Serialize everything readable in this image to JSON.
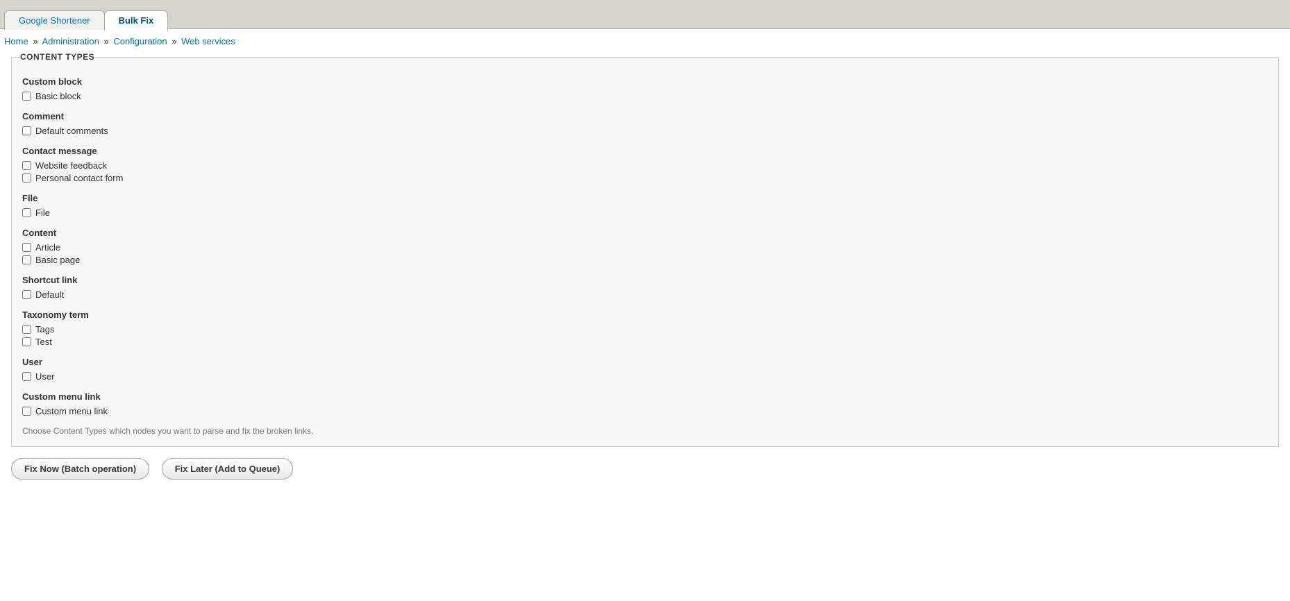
{
  "tabs": [
    {
      "label": "Google Shortener",
      "active": false
    },
    {
      "label": "Bulk Fix",
      "active": true
    }
  ],
  "breadcrumb": {
    "items": [
      {
        "label": "Home"
      },
      {
        "label": "Administration"
      },
      {
        "label": "Configuration"
      },
      {
        "label": "Web services"
      }
    ],
    "separator": "»"
  },
  "fieldset": {
    "legend": "CONTENT TYPES",
    "groups": [
      {
        "label": "Custom block",
        "options": [
          {
            "label": "Basic block",
            "checked": false
          }
        ]
      },
      {
        "label": "Comment",
        "options": [
          {
            "label": "Default comments",
            "checked": false
          }
        ]
      },
      {
        "label": "Contact message",
        "options": [
          {
            "label": "Website feedback",
            "checked": false
          },
          {
            "label": "Personal contact form",
            "checked": false
          }
        ]
      },
      {
        "label": "File",
        "options": [
          {
            "label": "File",
            "checked": false
          }
        ]
      },
      {
        "label": "Content",
        "options": [
          {
            "label": "Article",
            "checked": false
          },
          {
            "label": "Basic page",
            "checked": false
          }
        ]
      },
      {
        "label": "Shortcut link",
        "options": [
          {
            "label": "Default",
            "checked": false
          }
        ]
      },
      {
        "label": "Taxonomy term",
        "options": [
          {
            "label": "Tags",
            "checked": false
          },
          {
            "label": "Test",
            "checked": false
          }
        ]
      },
      {
        "label": "User",
        "options": [
          {
            "label": "User",
            "checked": false
          }
        ]
      },
      {
        "label": "Custom menu link",
        "options": [
          {
            "label": "Custom menu link",
            "checked": false
          }
        ]
      }
    ],
    "description": "Choose Content Types which nodes you want to parse and fix the broken links."
  },
  "buttons": {
    "fix_now": "Fix Now (Batch operation)",
    "fix_later": "Fix Later (Add to Queue)"
  }
}
